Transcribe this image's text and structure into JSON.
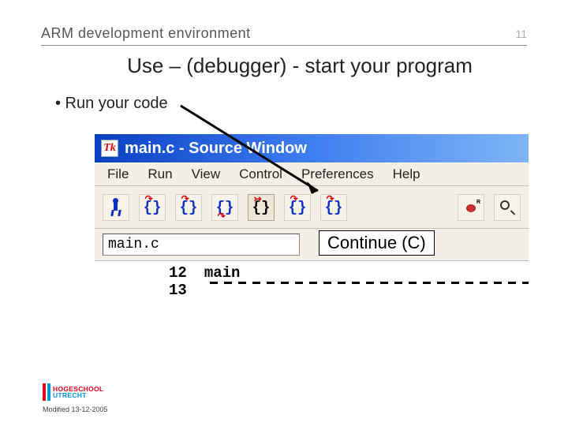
{
  "header": {
    "title": "ARM development environment",
    "page": "11"
  },
  "title": "Use – (debugger) - start your program",
  "bullet": "•  Run your code",
  "window": {
    "icon_text": "Tk",
    "titlebar": "main.c - Source Window",
    "menus": [
      "File",
      "Run",
      "View",
      "Control",
      "Preferences",
      "Help"
    ],
    "file_field": "main.c",
    "tooltip": "Continue (C)",
    "code": {
      "line1_num": "12",
      "line1_text": "main",
      "line2_num": "13",
      "line2_text": ""
    },
    "toolbar_icons": [
      "run-icon",
      "step-icon",
      "next-icon",
      "finish-icon",
      "continue-icon",
      "step-asm-icon",
      "next-asm-icon",
      "registers-icon",
      "memory-icon"
    ]
  },
  "footer": {
    "logo_top": "HOGESCHOOL",
    "logo_bottom": "UTRECHT",
    "modified": "Modified 13-12-2005"
  }
}
